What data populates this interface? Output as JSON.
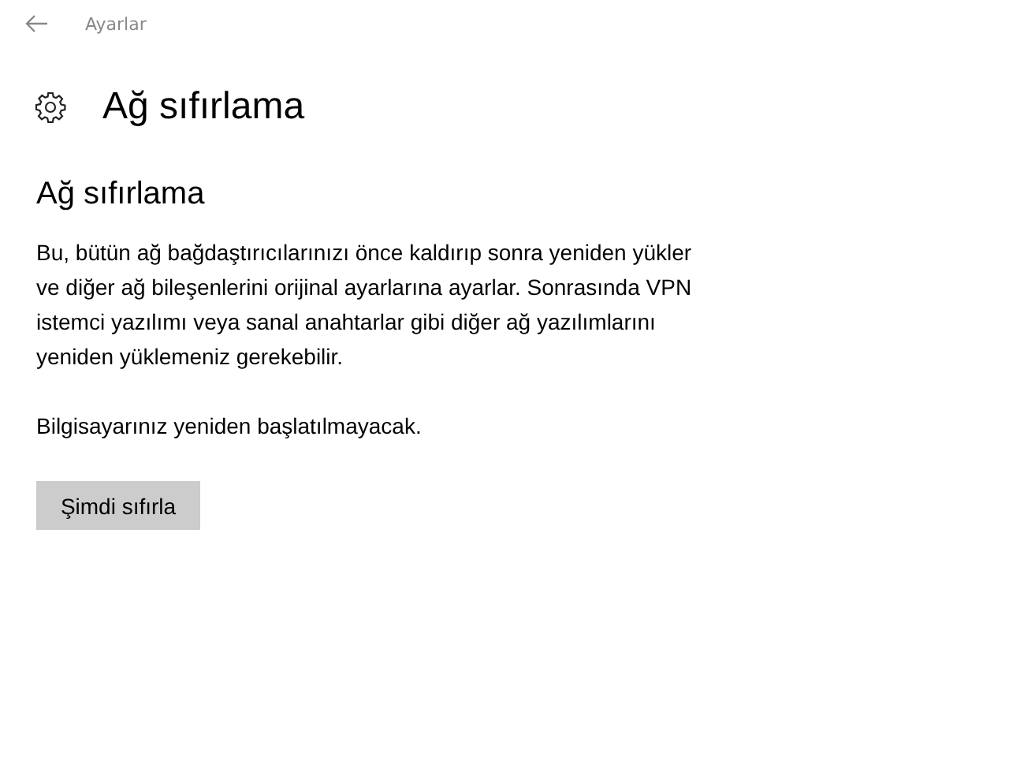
{
  "window": {
    "title": "Ayarlar"
  },
  "header": {
    "title": "Ağ sıfırlama"
  },
  "section": {
    "heading": "Ağ sıfırlama",
    "paragraphs": [
      "Bu, bütün ağ bağdaştırıcılarınızı önce kaldırıp sonra yeniden yükler\nve diğer ağ bileşenlerini orijinal ayarlarına ayarlar. Sonrasında VPN\nistemci yazılımı veya sanal anahtarlar gibi diğer ağ yazılımlarını\nyeniden yüklemeniz gerekebilir.",
      "Bilgisayarınız yeniden başlatılmayacak."
    ],
    "button": "Şimdi sıfırla"
  }
}
